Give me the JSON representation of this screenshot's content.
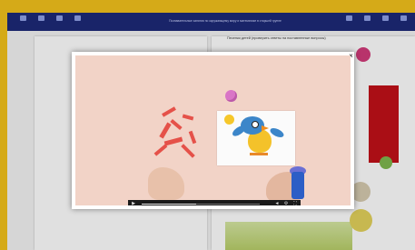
{
  "toolbar": {
    "title": "Познавательные занятия по окружающему миру и математике в старшей группе"
  },
  "page": {
    "right_heading": "Песенки детей (проверить ответы на поставленные вопросы)"
  },
  "video": {
    "progress": 0.46
  },
  "colors": {
    "background": "#f3c21c",
    "toolbar": "#1d2a78",
    "accent_red": "#c21019"
  }
}
